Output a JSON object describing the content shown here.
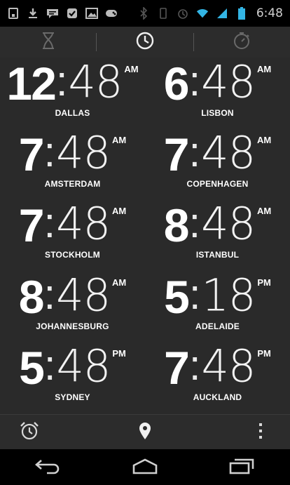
{
  "status_bar": {
    "time": "6:48",
    "left_icons": [
      "sim-download-icon",
      "download-icon",
      "chat-icon",
      "check-icon",
      "image-icon",
      "game-icon"
    ],
    "right_icons": [
      "bluetooth-icon",
      "rotate-icon",
      "alarm-icon",
      "wifi-icon",
      "signal-icon",
      "battery-icon"
    ]
  },
  "tabs": [
    {
      "name": "timer",
      "icon": "hourglass-icon",
      "active": false
    },
    {
      "name": "clock",
      "icon": "clock-icon",
      "active": true
    },
    {
      "name": "stopwatch",
      "icon": "stopwatch-icon",
      "active": false
    }
  ],
  "clocks": [
    {
      "hour": "12",
      "minutes": "48",
      "ampm": "AM",
      "city": "DALLAS"
    },
    {
      "hour": "6",
      "minutes": "48",
      "ampm": "AM",
      "city": "LISBON"
    },
    {
      "hour": "7",
      "minutes": "48",
      "ampm": "AM",
      "city": "AMSTERDAM"
    },
    {
      "hour": "7",
      "minutes": "48",
      "ampm": "AM",
      "city": "COPENHAGEN"
    },
    {
      "hour": "7",
      "minutes": "48",
      "ampm": "AM",
      "city": "STOCKHOLM"
    },
    {
      "hour": "8",
      "minutes": "48",
      "ampm": "AM",
      "city": "ISTANBUL"
    },
    {
      "hour": "8",
      "minutes": "48",
      "ampm": "AM",
      "city": "JOHANNESBURG"
    },
    {
      "hour": "5",
      "minutes": "18",
      "ampm": "PM",
      "city": "ADELAIDE"
    },
    {
      "hour": "5",
      "minutes": "48",
      "ampm": "PM",
      "city": "SYDNEY"
    },
    {
      "hour": "7",
      "minutes": "48",
      "ampm": "PM",
      "city": "AUCKLAND"
    }
  ],
  "action_bar": {
    "left": "alarm-icon",
    "center": "location-pin-icon",
    "right": "overflow-menu-icon"
  },
  "nav_bar": [
    "back-icon",
    "home-icon",
    "recent-apps-icon"
  ],
  "colors": {
    "background": "#2a2a2a",
    "bar": "#000000",
    "text": "#ffffff",
    "muted": "#9a9a9a"
  }
}
